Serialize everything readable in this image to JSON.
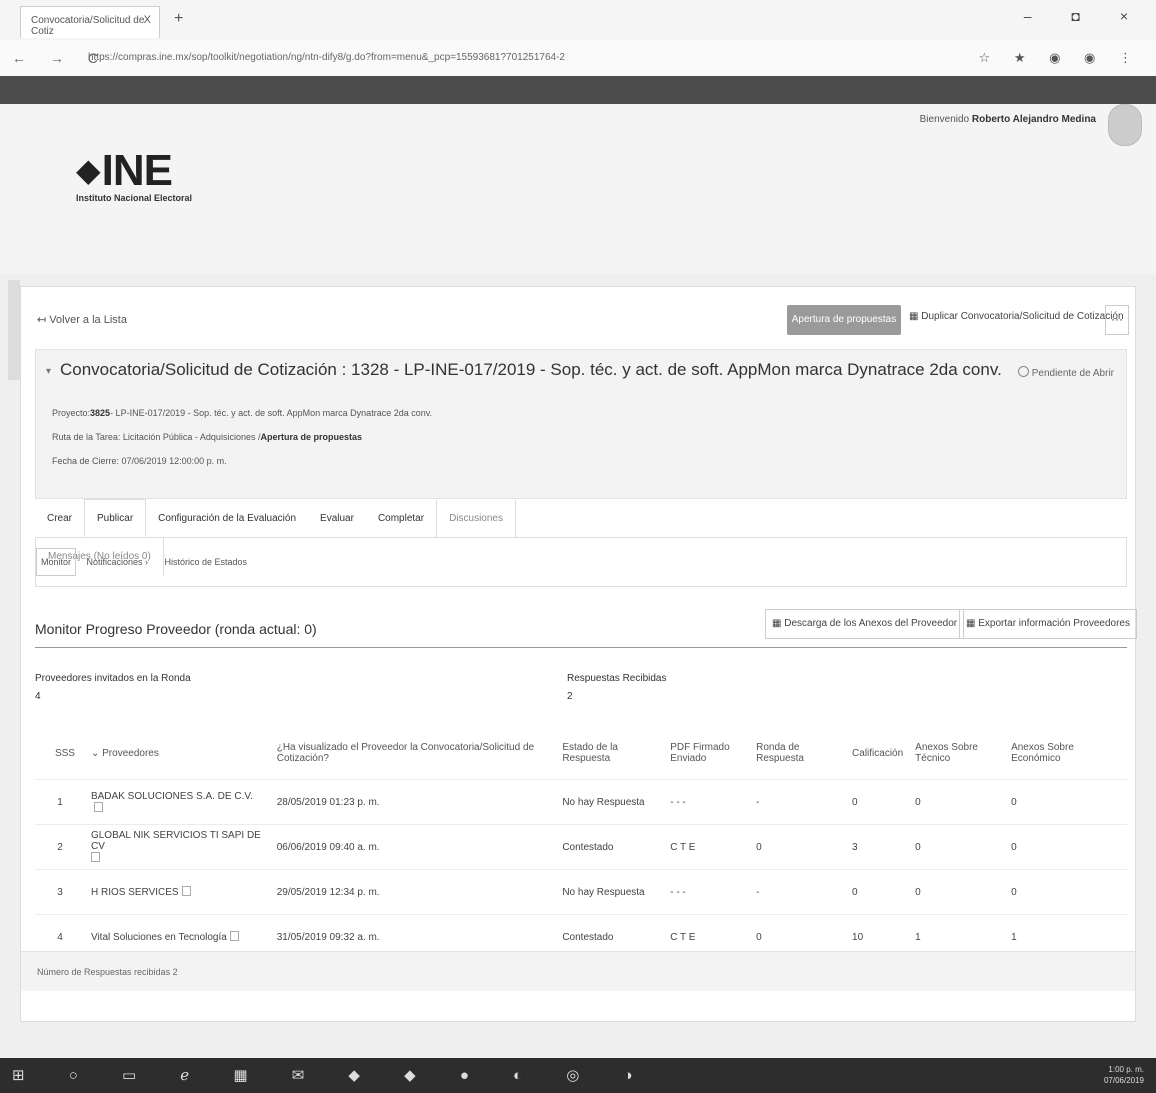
{
  "browser": {
    "tab_title": "Convocatoria/Solicitud de Cotiz",
    "tab_close": "X",
    "new_tab": "+",
    "window_controls": "–  ◘  ×",
    "nav_buttons": "← → C",
    "url": "https://compras.ine.mx/sop/toolkit/negotiation/ng/ntn-dify8/g.do?from=menu&_pcp=15593681?701251764-2",
    "address_icons": "☆ ★ ◉ ◉ ⋮"
  },
  "header": {
    "welcome_prefix": "Bienvenido",
    "user_name": "Roberto Alejandro Medina",
    "logo_text": "INE",
    "logo_subtitle": "Instituto Nacional Electoral"
  },
  "toolbar": {
    "back_link": "Volver a la Lista",
    "primary_button": "Apertura de propuestas",
    "duplicate_button": "Duplicar Convocatoria/Solicitud de Cotización",
    "more_button": "···"
  },
  "info": {
    "title": "Convocatoria/Solicitud de Cotización : 1328 - LP-INE-017/2019 - Sop. téc. y act. de soft. AppMon marca Dynatrace 2da conv.",
    "status": "Pendiente de Abrir",
    "project_label": "Proyecto:",
    "project_value_bold": "3825",
    "project_value": "- LP-INE-017/2019 - Sop. téc. y act. de soft. AppMon marca Dynatrace 2da conv.",
    "route_label": "Ruta de la Tarea: Licitación Pública - Adquisiciones /",
    "route_value": "Apertura de propuestas",
    "close_date": "Fecha de Cierre: 07/06/2019 12:00:00 p. m."
  },
  "tabs": [
    {
      "label": "Crear"
    },
    {
      "label": "Publicar"
    },
    {
      "label": "Configuración de la Evaluación"
    },
    {
      "label": "Evaluar"
    },
    {
      "label": "Completar"
    },
    {
      "label": "Discusiones"
    },
    {
      "label": "Mensajes (No leídos 0)"
    }
  ],
  "subtabs": [
    {
      "label": "Monitor"
    },
    {
      "label": "Notificaciones ›"
    },
    {
      "label": "Histórico de Estados"
    }
  ],
  "monitor": {
    "title": "Monitor Progreso Proveedor (ronda actual: 0)",
    "download_button": "Descarga de los Anexos del Proveedor",
    "export_button": "Exportar información Proveedores",
    "invited_label": "Proveedores invitados en la Ronda",
    "invited_value": "4",
    "received_label": "Respuestas Recibidas",
    "received_value": "2"
  },
  "table": {
    "headers": {
      "sss": "SSS",
      "sort_indicator": "⌄",
      "proveedores": "Proveedores",
      "visualizado": "¿Ha visualizado el Proveedor la Convocatoria/Solicitud de Cotización?",
      "estado": "Estado de la Respuesta",
      "pdf": "PDF Firmado Enviado",
      "ronda": "Ronda de Respuesta",
      "calificacion": "Calificación",
      "anexos_tecnico": "Anexos Sobre Técnico",
      "anexos_economico": "Anexos Sobre Económico"
    },
    "rows": [
      {
        "num": "1",
        "proveedor": "BADAK SOLUCIONES S.A. DE C.V.",
        "visualizado": "28/05/2019 01:23 p. m.",
        "estado": "No hay Respuesta",
        "pdf": "- - -",
        "ronda": "-",
        "calificacion": "0",
        "tecnico": "0",
        "economico": "0"
      },
      {
        "num": "2",
        "proveedor": "GLOBAL NIK SERVICIOS TI SAPI DE CV",
        "visualizado": "06/06/2019 09:40 a. m.",
        "estado": "Contestado",
        "pdf": "C T E",
        "ronda": "0",
        "calificacion": "3",
        "tecnico": "0",
        "economico": "0"
      },
      {
        "num": "3",
        "proveedor": "H RIOS SERVICES",
        "visualizado": "29/05/2019 12:34 p. m.",
        "estado": "No hay Respuesta",
        "pdf": "- - -",
        "ronda": "-",
        "calificacion": "0",
        "tecnico": "0",
        "economico": "0"
      },
      {
        "num": "4",
        "proveedor": "Vital Soluciones en Tecnología",
        "visualizado": "31/05/2019 09:32 a. m.",
        "estado": "Contestado",
        "pdf": "C T E",
        "ronda": "0",
        "calificacion": "10",
        "tecnico": "1",
        "economico": "1"
      }
    ]
  },
  "footer": {
    "responses_count": "Número de Respuestas recibidas 2"
  },
  "taskbar": {
    "icons": "⊞ ○ ▭ ℯ ▦ ✉ ◆ ◆ ● ◐ ◎ ◑",
    "clock_time": "1:00 p. m.",
    "clock_date": "07/06/2019"
  }
}
